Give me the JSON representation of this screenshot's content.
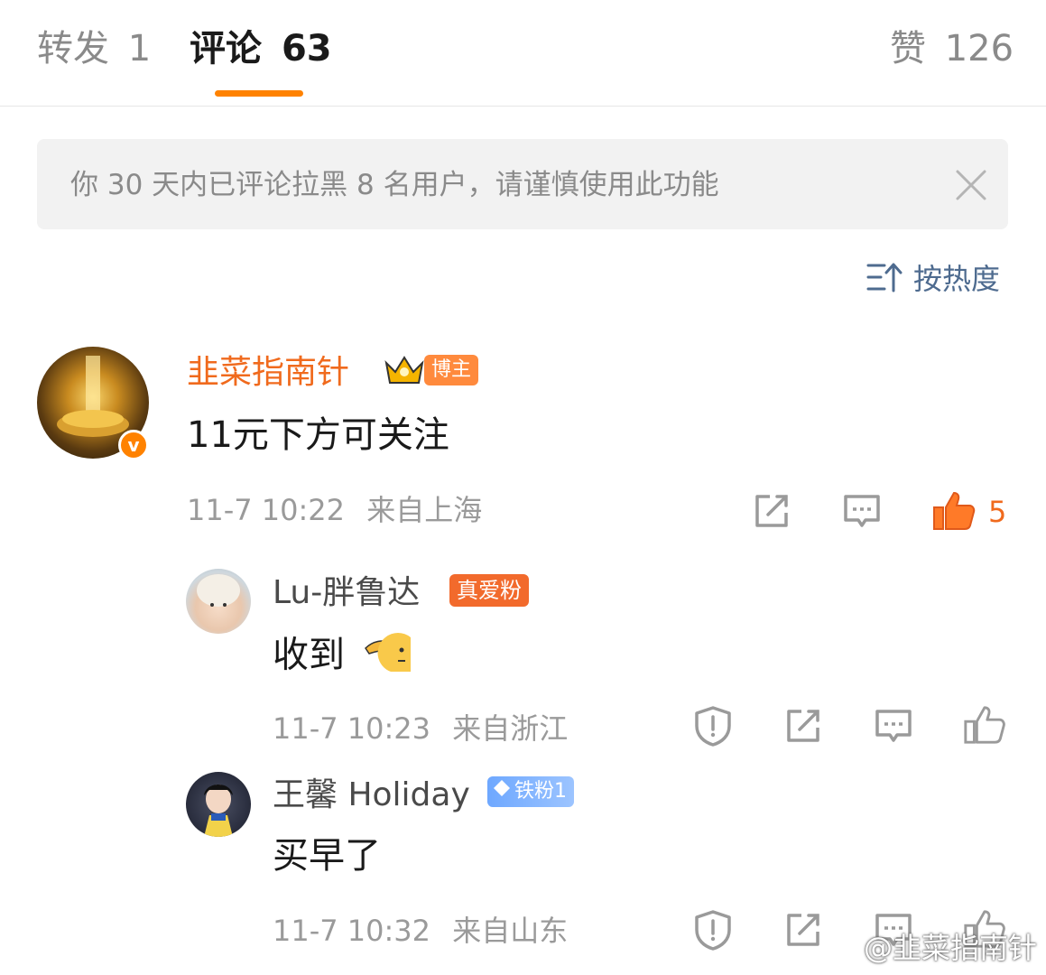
{
  "tabs": {
    "repost_label": "转发",
    "repost_count": "1",
    "comment_label": "评论",
    "comment_count": "63",
    "like_label": "赞",
    "like_count": "126"
  },
  "notice": {
    "text": "你 30 天内已评论拉黑 8 名用户，请谨慎使用此功能"
  },
  "sort": {
    "label": "按热度"
  },
  "comments": [
    {
      "username": "韭菜指南针",
      "badge": "博主",
      "text": "11元下方可关注",
      "time": "11-7 10:22",
      "location": "来自上海",
      "likes": "5"
    }
  ],
  "replies": [
    {
      "username": "Lu-胖鲁达",
      "badge": "真爱粉",
      "text": "收到",
      "time": "11-7 10:23",
      "location": "来自浙江"
    },
    {
      "username": "王馨 Holiday",
      "badge": "铁粉1",
      "text": "买早了",
      "time": "11-7 10:32",
      "location": "来自山东"
    }
  ],
  "watermark": "@韭菜指南针",
  "colors": {
    "accent": "#ff8200",
    "username_orange": "#f06a1d",
    "link_blue": "#4e6b8f",
    "muted": "#9a9a9a"
  }
}
